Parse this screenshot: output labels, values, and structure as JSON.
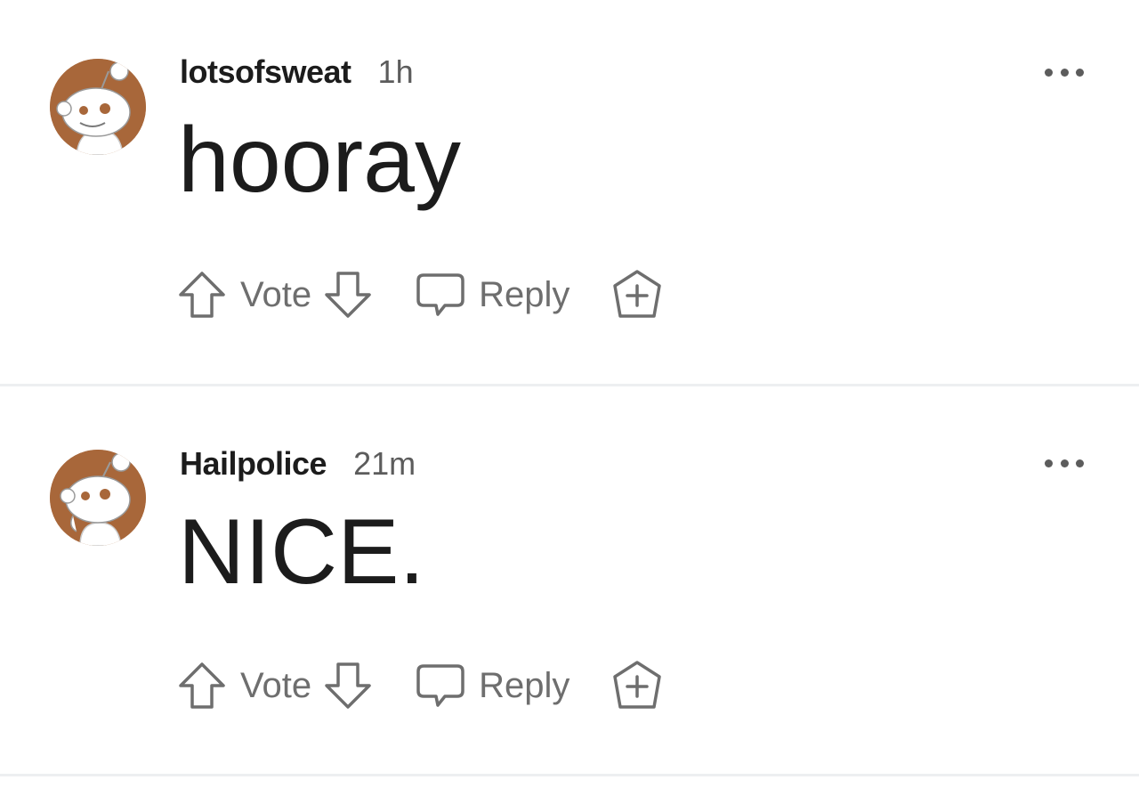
{
  "comments": [
    {
      "username": "lotsofsweat",
      "time": "1h",
      "body": "hooray",
      "vote_label": "Vote",
      "reply_label": "Reply"
    },
    {
      "username": "Hailpolice",
      "time": "21m",
      "body": "NICE.",
      "vote_label": "Vote",
      "reply_label": "Reply"
    }
  ],
  "colors": {
    "avatar_bg": "#a8673a",
    "text": "#1c1c1c",
    "muted": "#6e6e6e",
    "divider": "#edeff1"
  },
  "icons": [
    "snoo-avatar-icon",
    "more-options-icon",
    "upvote-arrow-icon",
    "downvote-arrow-icon",
    "reply-bubble-icon",
    "award-icon"
  ]
}
